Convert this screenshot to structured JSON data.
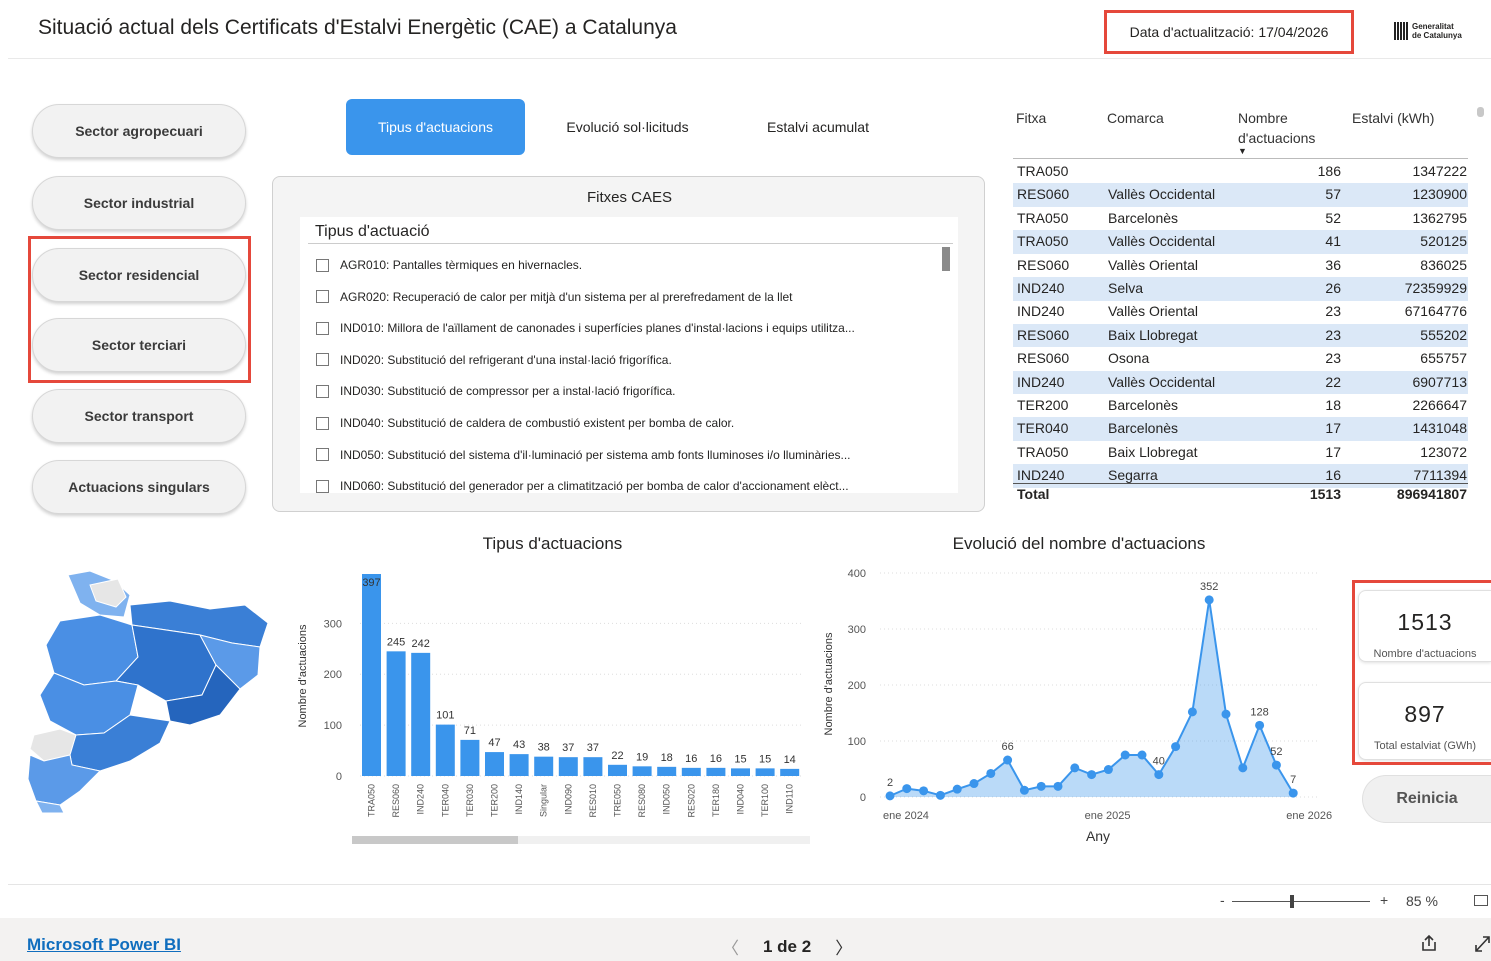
{
  "header": {
    "title": "Situació actual dels Certificats d'Estalvi Energètic (CAE) a Catalunya",
    "update_label": "Data d'actualització: 17/04/2026",
    "logo_line1": "Generalitat",
    "logo_line2": "de Catalunya"
  },
  "sectors": [
    {
      "label": "Sector agropecuari"
    },
    {
      "label": "Sector industrial"
    },
    {
      "label": "Sector residencial"
    },
    {
      "label": "Sector terciari"
    },
    {
      "label": "Sector transport"
    },
    {
      "label": "Actuacions singulars"
    }
  ],
  "tabs": [
    {
      "label": "Tipus d'actuacions",
      "active": true
    },
    {
      "label": "Evolució sol·licituds"
    },
    {
      "label": "Estalvi acumulat"
    }
  ],
  "fitxes": {
    "title": "Fitxes CAES",
    "slicer_header": "Tipus d'actuació",
    "items": [
      "AGR010: Pantalles tèrmiques en hivernacles.",
      "AGR020: Recuperació de calor per mitjà d'un sistema per al prerefredament de la llet",
      "IND010: Millora de l'aïllament de canonades i superfícies planes d'instal·lacions i equips utilitza...",
      "IND020: Substitució del refrigerant d'una instal·lació frigorífica.",
      "IND030: Substitució de compressor per a instal·lació frigorífica.",
      "IND040: Substitució de caldera de combustió existent per bomba de calor.",
      "IND050: Substitució del sistema d'il·luminació per sistema amb fonts lluminoses i/o lluminàries...",
      "IND060: Substitució del generador per a climatització per bomba de calor d'accionament elèct..."
    ]
  },
  "table": {
    "headers": [
      "Fitxa",
      "Comarca",
      "Nombre d'actuacions",
      "Estalvi (kWh)"
    ],
    "rows": [
      {
        "fitxa": "TRA050",
        "comarca": "",
        "n": "186",
        "estalvi": "1347222"
      },
      {
        "fitxa": "RES060",
        "comarca": "Vallès Occidental",
        "n": "57",
        "estalvi": "1230900"
      },
      {
        "fitxa": "TRA050",
        "comarca": "Barcelonès",
        "n": "52",
        "estalvi": "1362795"
      },
      {
        "fitxa": "TRA050",
        "comarca": "Vallès Occidental",
        "n": "41",
        "estalvi": "520125"
      },
      {
        "fitxa": "RES060",
        "comarca": "Vallès Oriental",
        "n": "36",
        "estalvi": "836025"
      },
      {
        "fitxa": "IND240",
        "comarca": "Selva",
        "n": "26",
        "estalvi": "72359929"
      },
      {
        "fitxa": "IND240",
        "comarca": "Vallès Oriental",
        "n": "23",
        "estalvi": "67164776"
      },
      {
        "fitxa": "RES060",
        "comarca": "Baix Llobregat",
        "n": "23",
        "estalvi": "555202"
      },
      {
        "fitxa": "RES060",
        "comarca": "Osona",
        "n": "23",
        "estalvi": "655757"
      },
      {
        "fitxa": "IND240",
        "comarca": "Vallès Occidental",
        "n": "22",
        "estalvi": "6907713"
      },
      {
        "fitxa": "TER200",
        "comarca": "Barcelonès",
        "n": "18",
        "estalvi": "2266647"
      },
      {
        "fitxa": "TER040",
        "comarca": "Barcelonès",
        "n": "17",
        "estalvi": "1431048"
      },
      {
        "fitxa": "TRA050",
        "comarca": "Baix Llobregat",
        "n": "17",
        "estalvi": "123072"
      },
      {
        "fitxa": "IND240",
        "comarca": "Segarra",
        "n": "16",
        "estalvi": "7711394"
      }
    ],
    "total": {
      "label": "Total",
      "n": "1513",
      "estalvi": "896941807"
    }
  },
  "kpis": {
    "count_value": "1513",
    "count_label": "Nombre d'actuacions",
    "saving_value": "897",
    "saving_label": "Total estalviat (GWh)",
    "reset_label": "Reinicia"
  },
  "chart_data": [
    {
      "type": "bar",
      "title": "Tipus d'actuacions",
      "xlabel": "",
      "ylabel": "Nombre d'actuacions",
      "ylim": [
        0,
        397
      ],
      "yticks": [
        0,
        100,
        200,
        300
      ],
      "categories": [
        "TRA050",
        "RES060",
        "IND240",
        "TER040",
        "TER030",
        "TER200",
        "IND140",
        "Singular",
        "IND090",
        "RES010",
        "TRE050",
        "RES080",
        "IND050",
        "RES020",
        "TER180",
        "IND040",
        "TER100",
        "IND110"
      ],
      "values": [
        397,
        245,
        242,
        101,
        71,
        47,
        43,
        38,
        37,
        37,
        22,
        19,
        18,
        16,
        16,
        15,
        15,
        14
      ],
      "color": "#3a95ec"
    },
    {
      "type": "area",
      "title": "Evolució del nombre d'actuacions",
      "xlabel": "Any",
      "ylabel": "Nombre d'actuacions",
      "ylim": [
        0,
        400
      ],
      "yticks": [
        0,
        100,
        200,
        300,
        400
      ],
      "xticks": [
        "ene 2024",
        "ene 2025",
        "ene 2026"
      ],
      "x": [
        "2024-01",
        "2024-02",
        "2024-03",
        "2024-04",
        "2024-05",
        "2024-06",
        "2024-07",
        "2024-08",
        "2024-09",
        "2024-10",
        "2024-11",
        "2024-12",
        "2025-01",
        "2025-02",
        "2025-03",
        "2025-04",
        "2025-05",
        "2025-06",
        "2025-07",
        "2025-08",
        "2025-09",
        "2025-10",
        "2025-11",
        "2025-12",
        "2026-01",
        "2026-02"
      ],
      "values": [
        2,
        15,
        11,
        3,
        14,
        24,
        42,
        66,
        12,
        19,
        19,
        52,
        40,
        49,
        75,
        75,
        40,
        90,
        152,
        352,
        148,
        52,
        128,
        57,
        7,
        null
      ],
      "labels": {
        "0": "2",
        "7": "66",
        "16": "40",
        "19": "352",
        "22": "128",
        "23": "52",
        "24": "7"
      },
      "color": "#3a95ec"
    }
  ],
  "footer": {
    "powerbi_link": "Microsoft Power BI",
    "page_label": "1 de 2",
    "zoom_label": "85 %",
    "zoom_minus": "-",
    "zoom_plus": "+"
  }
}
